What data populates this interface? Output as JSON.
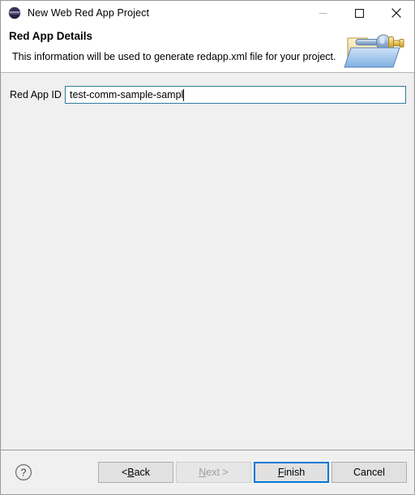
{
  "window": {
    "title": "New Web Red App Project",
    "icon": "eclipse-sphere-icon",
    "controls": {
      "minimize": "minimize-icon",
      "maximize": "maximize-icon",
      "close": "close-icon"
    }
  },
  "banner": {
    "title": "Red App Details",
    "description": "This information will be used to generate redapp.xml file for your project.",
    "icon": "new-project-folder-icon"
  },
  "form": {
    "red_app_id": {
      "label": "Red App ID",
      "value": "test-comm-sample-sampl",
      "placeholder": ""
    }
  },
  "footer": {
    "help": "help-icon",
    "buttons": {
      "back": {
        "prefix": "< ",
        "mnemonic": "B",
        "suffix": "ack",
        "enabled": true
      },
      "next": {
        "prefix": "",
        "mnemonic": "N",
        "suffix": "ext >",
        "enabled": false
      },
      "finish": {
        "prefix": "",
        "mnemonic": "F",
        "suffix": "inish",
        "enabled": true,
        "default": true
      },
      "cancel": {
        "prefix": "",
        "mnemonic": "",
        "suffix": "Cancel",
        "enabled": true
      }
    }
  },
  "colors": {
    "accent": "#0078d7",
    "titlebar_bg": "#ffffff",
    "dialog_bg": "#f0f0f0",
    "input_border": "#2e7d9a",
    "button_bg": "#e1e1e1"
  }
}
